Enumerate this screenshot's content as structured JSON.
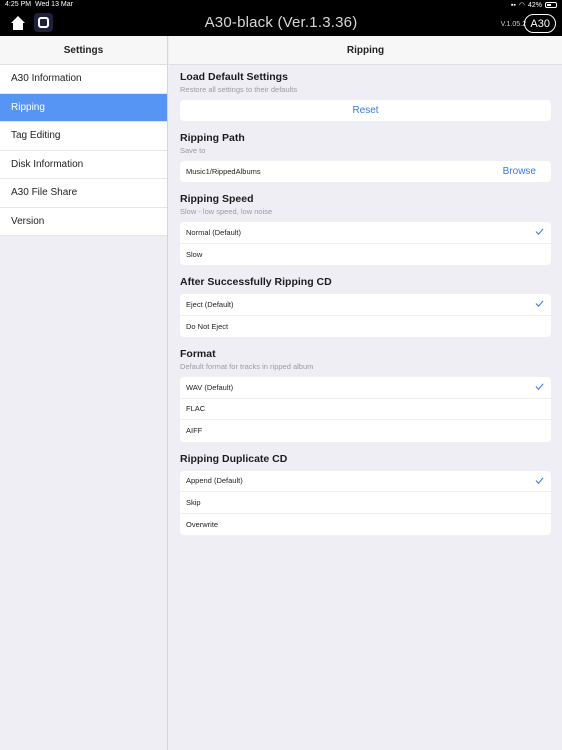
{
  "status_bar": {
    "time": "4:25 PM",
    "date": "Wed 13 Mar",
    "battery": "42%"
  },
  "header": {
    "title": "A30-black (Ver.1.3.36)",
    "version": "V.1.05.2",
    "device_button": "A30",
    "home_icon": "home-icon",
    "square_icon": "square-icon"
  },
  "sidebar": {
    "title": "Settings",
    "items": [
      {
        "label": "A30 Information",
        "active": false
      },
      {
        "label": "Ripping",
        "active": true
      },
      {
        "label": "Tag Editing",
        "active": false
      },
      {
        "label": "Disk Information",
        "active": false
      },
      {
        "label": "A30 File Share",
        "active": false
      },
      {
        "label": "Version",
        "active": false
      }
    ]
  },
  "main": {
    "title": "Ripping",
    "load_defaults": {
      "title": "Load Default Settings",
      "subtitle": "Restore all settings to their defaults",
      "button": "Reset"
    },
    "ripping_path": {
      "title": "Ripping Path",
      "subtitle": "Save to",
      "value": "Music1/RippedAlbums",
      "button": "Browse"
    },
    "ripping_speed": {
      "title": "Ripping Speed",
      "subtitle": "Slow - low speed, low noise",
      "options": [
        "Normal (Default)",
        "Slow"
      ],
      "selected": 0
    },
    "after_ripping": {
      "title": "After Successfully Ripping CD",
      "options": [
        "Eject (Default)",
        "Do Not Eject"
      ],
      "selected": 0
    },
    "format": {
      "title": "Format",
      "subtitle": "Default format for tracks in ripped album",
      "options": [
        "WAV (Default)",
        "FLAC",
        "AIFF"
      ],
      "selected": 0
    },
    "duplicate": {
      "title": "Ripping Duplicate CD",
      "options": [
        "Append (Default)",
        "Skip",
        "Overwrite"
      ],
      "selected": 0
    }
  },
  "colors": {
    "accent": "#5795f5",
    "link": "#3a7ad9",
    "background": "#efeef4"
  }
}
